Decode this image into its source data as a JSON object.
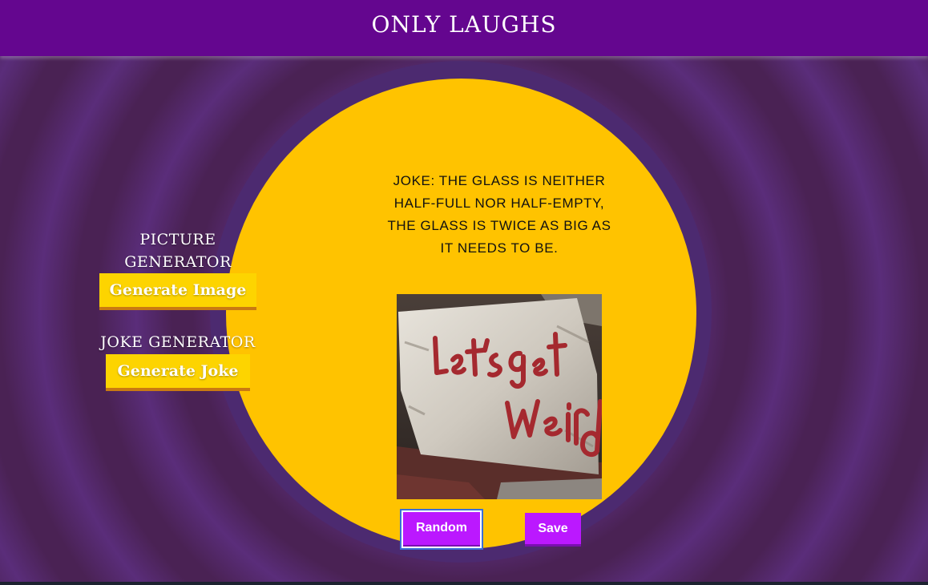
{
  "header": {
    "title": "ONLY LAUGHS"
  },
  "picture_generator": {
    "label": "PICTURE GENERATOR",
    "button_label": "Generate Image"
  },
  "joke_generator": {
    "label": "JOKE GENERATOR",
    "button_label": "Generate Joke"
  },
  "joke": {
    "text": "JOKE: THE GLASS IS NEITHER HALF-FULL NOR HALF-EMPTY, THE GLASS IS TWICE AS BIG AS IT NEEDS TO BE."
  },
  "image": {
    "painted_text": "Let's get Weird"
  },
  "actions": {
    "random_label": "Random",
    "save_label": "Save"
  },
  "colors": {
    "header_bg": "#64068f",
    "circle": "#ffc300",
    "generator_button": "#fdd400",
    "action_button": "#bb18ff"
  }
}
